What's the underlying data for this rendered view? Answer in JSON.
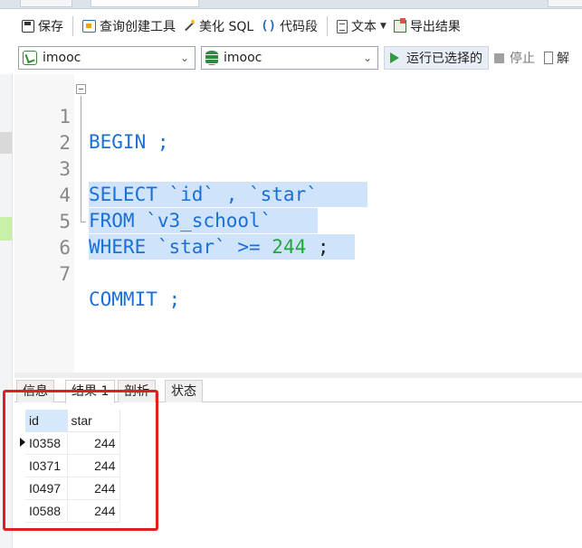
{
  "toolbar": {
    "save": "保存",
    "query_builder": "查询创建工具",
    "beautify_sql": "美化 SQL",
    "code_snippet": "代码段",
    "text": "文本",
    "export_results": "导出结果"
  },
  "connection": {
    "connection_name": "imooc",
    "database_name": "imooc",
    "run_selected": "运行已选择的",
    "stop": "停止",
    "explain": "解"
  },
  "editor": {
    "lines": [
      {
        "num": "1",
        "text": "BEGIN ;"
      },
      {
        "num": "2",
        "text": ""
      },
      {
        "num": "3",
        "text": "SELECT `id` , `star`"
      },
      {
        "num": "4",
        "text": "FROM `v3_school`"
      },
      {
        "num": "5",
        "text": "WHERE `star` >= 244 ;"
      },
      {
        "num": "6",
        "text": ""
      },
      {
        "num": "7",
        "text": "COMMIT ;"
      }
    ]
  },
  "result_tabs": {
    "info": "信息",
    "result1": "结果 1",
    "profile": "剖析",
    "status": "状态"
  },
  "result_grid": {
    "columns": [
      "id",
      "star"
    ],
    "rows": [
      [
        "I0358",
        "244"
      ],
      [
        "I0371",
        "244"
      ],
      [
        "I0497",
        "244"
      ],
      [
        "I0588",
        "244"
      ]
    ]
  },
  "colors": {
    "keyword": "#1a6fd8",
    "number": "#22a83a",
    "selection": "#cfe3fb",
    "highlight_box": "#e02020"
  },
  "icons": [
    "save-icon",
    "query-builder-icon",
    "beautify-icon",
    "code-snippet-icon",
    "text-icon",
    "export-icon",
    "connection-icon",
    "database-icon",
    "run-icon",
    "stop-icon",
    "explain-icon"
  ]
}
